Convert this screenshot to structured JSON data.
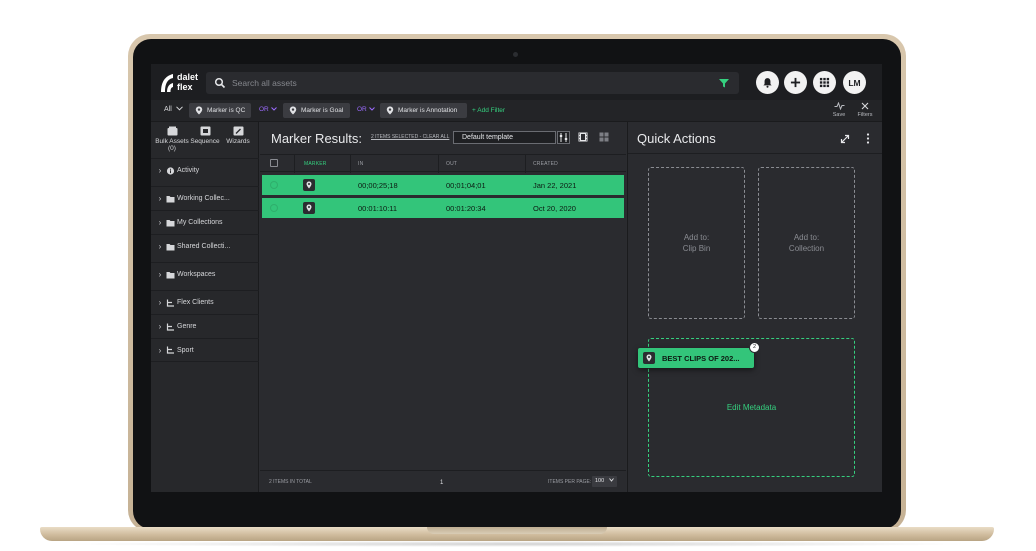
{
  "brand": {
    "logo_line1": "dalet",
    "logo_line2": "flex"
  },
  "search": {
    "placeholder": "Search all assets",
    "value": ""
  },
  "user": {
    "initials": "LM"
  },
  "filterbar": {
    "scope": "All",
    "chips": [
      {
        "label": "Marker is QC"
      },
      {
        "label": "Marker is Goal"
      },
      {
        "label": "Marker is Annotation"
      }
    ],
    "operators": [
      "OR",
      "OR"
    ],
    "add_filter": "+ Add Filter",
    "save_label": "Save",
    "filters_label": "Filters"
  },
  "sidebar": {
    "tools": [
      {
        "label": "Bulk Assets (0)",
        "icon": "bulk-assets-icon"
      },
      {
        "label": "Sequence",
        "icon": "sequence-icon"
      },
      {
        "label": "Wizards",
        "icon": "wizard-icon"
      }
    ],
    "items": [
      {
        "label": "Activity",
        "icon": "info-icon"
      },
      {
        "label": "Working Collec...",
        "icon": "folder-icon"
      },
      {
        "label": "My Collections",
        "icon": "folder-icon"
      },
      {
        "label": "Shared Collecti...",
        "icon": "folder-icon"
      },
      {
        "label": "Workspaces",
        "icon": "folder-icon"
      },
      {
        "label": "Flex Clients",
        "icon": "hierarchy-icon"
      },
      {
        "label": "Genre",
        "icon": "hierarchy-icon"
      },
      {
        "label": "Sport",
        "icon": "hierarchy-icon"
      }
    ]
  },
  "results": {
    "title": "Marker Results:",
    "selected_link": "2 ITEMS SELECTED - CLEAR ALL",
    "template": "Default template",
    "columns": {
      "marker": "MARKER",
      "in": "IN",
      "out": "OUT",
      "created": "CREATED"
    },
    "rows": [
      {
        "in": "00;00;25;18",
        "out": "00;01;04;01",
        "created": "Jan 22, 2021"
      },
      {
        "in": "00:01:10:11",
        "out": "00:01:20:34",
        "created": "Oct 20, 2020"
      }
    ],
    "total": "2 ITEMS IN TOTAL",
    "page": "1",
    "per_page_label": "ITEMS PER PAGE:",
    "per_page": "100"
  },
  "quick_actions": {
    "title": "Quick Actions",
    "zones": [
      {
        "label": "Add to:\nClip Bin"
      },
      {
        "label": "Add to:\nCollection"
      },
      {
        "label": "Edit Metadata"
      }
    ],
    "drag_card": {
      "label": "BEST CLIPS OF 202...",
      "count": "2"
    }
  },
  "colors": {
    "accent": "#33c57a",
    "operator": "#9c6bff",
    "background": "#2b2c30"
  }
}
